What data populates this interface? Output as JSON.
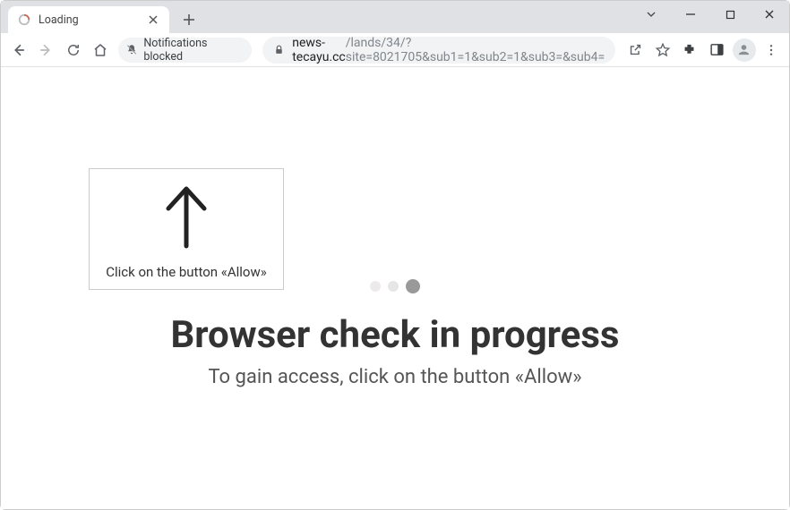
{
  "window": {
    "tab_title": "Loading"
  },
  "toolbar": {
    "notifications_chip": "Notifications blocked",
    "url_domain": "news-tecayu.cc",
    "url_path": "/lands/34/?site=8021705&sub1=1&sub2=1&sub3=&sub4="
  },
  "page": {
    "callout_text": "Click on the button «Allow»",
    "headline": "Browser check in progress",
    "subheadline": "To gain access, click on the button «Allow»"
  }
}
